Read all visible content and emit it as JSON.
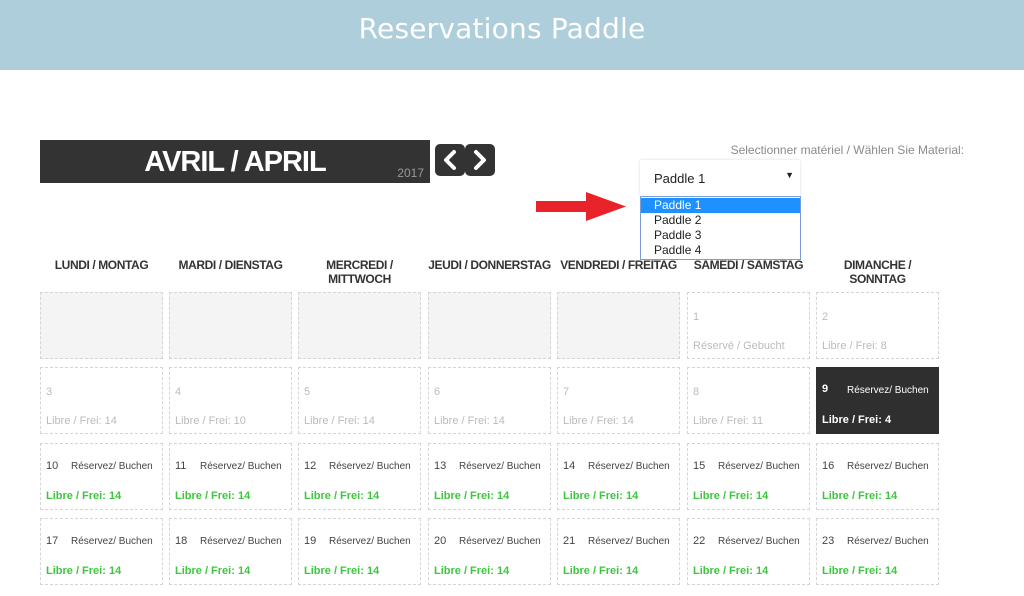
{
  "header": {
    "title": "Reservations Paddle"
  },
  "calendar": {
    "month_label": "AVRIL / APRIL",
    "year": "2017",
    "prev_icon": "chevron-left-icon",
    "next_icon": "chevron-right-icon",
    "day_headers": [
      "LUNDI / MONTAG",
      "MARDI / DIENSTAG",
      "MERCREDI / MITTWOCH",
      "JEUDI / DONNERSTAG",
      "VENDREDI / FREITAG",
      "SAMEDI / SAMSTAG",
      "DIMANCHE / SONNTAG"
    ],
    "weeks": [
      [
        {
          "type": "empty"
        },
        {
          "type": "empty"
        },
        {
          "type": "empty"
        },
        {
          "type": "empty"
        },
        {
          "type": "empty"
        },
        {
          "type": "past",
          "day": "1",
          "status": "Réservé / Gebucht"
        },
        {
          "type": "past",
          "day": "2",
          "status": "Libre / Frei: 8"
        }
      ],
      [
        {
          "type": "past",
          "day": "3",
          "status": "Libre / Frei: 14"
        },
        {
          "type": "past",
          "day": "4",
          "status": "Libre / Frei: 10"
        },
        {
          "type": "past",
          "day": "5",
          "status": "Libre / Frei: 14"
        },
        {
          "type": "past",
          "day": "6",
          "status": "Libre / Frei: 14"
        },
        {
          "type": "past",
          "day": "7",
          "status": "Libre / Frei: 14"
        },
        {
          "type": "past",
          "day": "8",
          "status": "Libre / Frei: 11"
        },
        {
          "type": "today",
          "day": "9",
          "book": "Réservez/ Buchen",
          "status": "Libre / Frei: 4"
        }
      ],
      [
        {
          "type": "open",
          "day": "10",
          "book": "Réservez/ Buchen",
          "status": "Libre / Frei: 14"
        },
        {
          "type": "open",
          "day": "11",
          "book": "Réservez/ Buchen",
          "status": "Libre / Frei: 14"
        },
        {
          "type": "open",
          "day": "12",
          "book": "Réservez/ Buchen",
          "status": "Libre / Frei: 14"
        },
        {
          "type": "open",
          "day": "13",
          "book": "Réservez/ Buchen",
          "status": "Libre / Frei: 14"
        },
        {
          "type": "open",
          "day": "14",
          "book": "Réservez/ Buchen",
          "status": "Libre / Frei: 14"
        },
        {
          "type": "open",
          "day": "15",
          "book": "Réservez/ Buchen",
          "status": "Libre / Frei: 14"
        },
        {
          "type": "open",
          "day": "16",
          "book": "Réservez/ Buchen",
          "status": "Libre / Frei: 14"
        }
      ],
      [
        {
          "type": "open",
          "day": "17",
          "book": "Réservez/ Buchen",
          "status": "Libre / Frei: 14"
        },
        {
          "type": "open",
          "day": "18",
          "book": "Réservez/ Buchen",
          "status": "Libre / Frei: 14"
        },
        {
          "type": "open",
          "day": "19",
          "book": "Réservez/ Buchen",
          "status": "Libre / Frei: 14"
        },
        {
          "type": "open",
          "day": "20",
          "book": "Réservez/ Buchen",
          "status": "Libre / Frei: 14"
        },
        {
          "type": "open",
          "day": "21",
          "book": "Réservez/ Buchen",
          "status": "Libre / Frei: 14"
        },
        {
          "type": "open",
          "day": "22",
          "book": "Réservez/ Buchen",
          "status": "Libre / Frei: 14"
        },
        {
          "type": "open",
          "day": "23",
          "book": "Réservez/ Buchen",
          "status": "Libre / Frei: 14"
        }
      ]
    ]
  },
  "material": {
    "label": "Selectionner matériel / Wählen Sie Material:",
    "selected": "Paddle 1",
    "caret_icon": "caret-down-icon",
    "options": [
      "Paddle 1",
      "Paddle 2",
      "Paddle 3",
      "Paddle 4"
    ],
    "highlighted_index": 0
  },
  "annotation": {
    "arrow_icon": "red-arrow-icon",
    "arrow_color": "#e8242a"
  },
  "colors": {
    "header_bg": "#aecedb",
    "dark": "#333333",
    "free_green": "#3ec63e",
    "highlight": "#1e90ff"
  }
}
